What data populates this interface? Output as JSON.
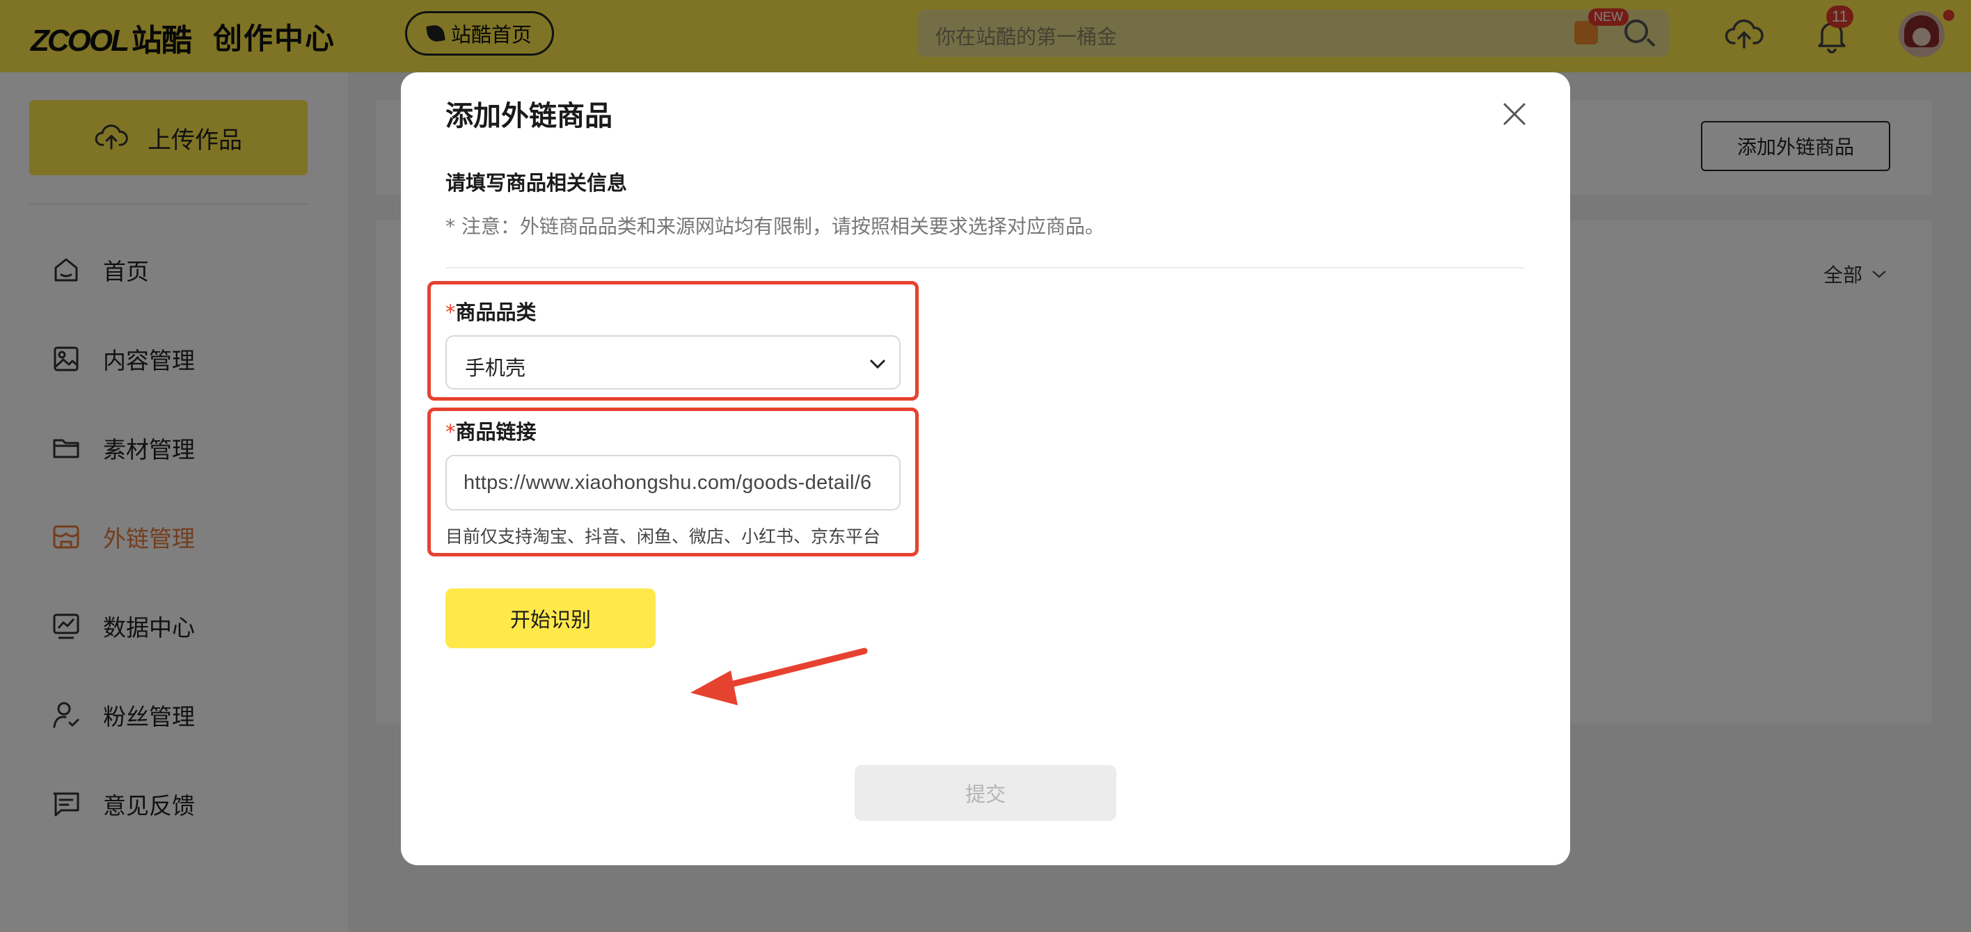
{
  "header": {
    "logo_mark": "ZCOOL",
    "logo_text": "站酷",
    "section_title": "创作中心",
    "home_button": "站酷首页",
    "search_placeholder": "你在站酷的第一桶金",
    "new_badge": "NEW",
    "notification_count": "11"
  },
  "sidebar": {
    "upload_label": "上传作品",
    "items": [
      {
        "label": "首页",
        "icon": "home-icon"
      },
      {
        "label": "内容管理",
        "icon": "image-icon"
      },
      {
        "label": "素材管理",
        "icon": "folder-icon"
      },
      {
        "label": "外链管理",
        "icon": "storefront-icon",
        "active": true
      },
      {
        "label": "数据中心",
        "icon": "chart-icon"
      },
      {
        "label": "粉丝管理",
        "icon": "user-icon"
      },
      {
        "label": "意见反馈",
        "icon": "feedback-icon"
      }
    ]
  },
  "main": {
    "add_link_button": "添加外链商品",
    "filter_label": "全部"
  },
  "modal": {
    "title": "添加外链商品",
    "section_title": "请填写商品相关信息",
    "notice": "* 注意：外链商品品类和来源网站均有限制，请按照相关要求选择对应商品。",
    "category": {
      "required_mark": "*",
      "label": "商品品类",
      "value": "手机壳"
    },
    "link": {
      "required_mark": "*",
      "label": "商品链接",
      "value": "https://www.xiaohongshu.com/goods-detail/6",
      "hint": "目前仅支持淘宝、抖音、闲鱼、微店、小红书、京东平台"
    },
    "start_button": "开始识别",
    "submit_button": "提交"
  },
  "colors": {
    "brand_yellow": "#ffe94a",
    "highlight_red": "#e5422f",
    "active_orange": "#e87a3a"
  }
}
